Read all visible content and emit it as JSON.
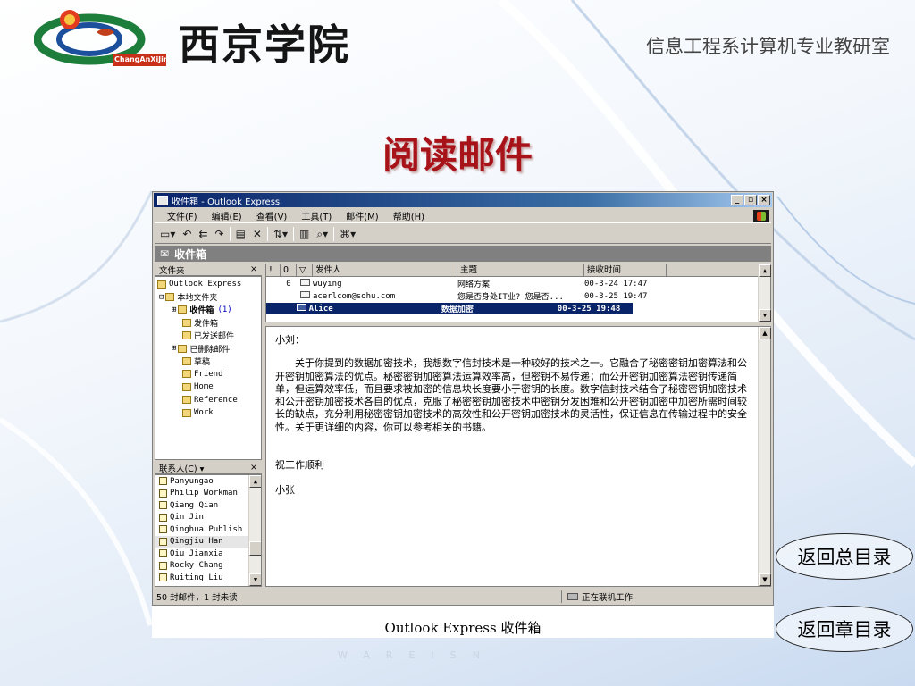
{
  "header": {
    "logo_caption": "ChangAnXiJing",
    "school_name": "西京学院",
    "department": "信息工程系计算机专业教研室"
  },
  "slide_title": "阅读邮件",
  "window": {
    "title": "收件箱 - Outlook Express",
    "menus": [
      "文件(F)",
      "编辑(E)",
      "查看(V)",
      "工具(T)",
      "邮件(M)",
      "帮助(H)"
    ],
    "toolbar_icons": [
      "new-mail-icon",
      "reply-icon",
      "reply-all-icon",
      "forward-icon",
      "print-icon",
      "delete-icon",
      "send-receive-icon",
      "addresses-icon",
      "find-icon",
      "encoding-icon"
    ],
    "folder_bar_title": "收件箱",
    "folders_header": "文件夹",
    "folders": [
      {
        "label": "Outlook Express",
        "level": 0
      },
      {
        "label": "本地文件夹",
        "level": 1
      },
      {
        "label": "收件箱",
        "count": "(1)",
        "level": 2,
        "bold": true
      },
      {
        "label": "发件箱",
        "level": 2
      },
      {
        "label": "已发送邮件",
        "level": 2
      },
      {
        "label": "已删除邮件",
        "level": 2
      },
      {
        "label": "草稿",
        "level": 2
      },
      {
        "label": "Friend",
        "level": 2
      },
      {
        "label": "Home",
        "level": 2
      },
      {
        "label": "Reference",
        "level": 2
      },
      {
        "label": "Work",
        "level": 2
      }
    ],
    "contacts_header": "联系人(C) ▾",
    "contacts": [
      "Panyungao",
      "Philip Workman",
      "Qiang Qian",
      "Qin Jin",
      "Qinghua Publish",
      "Qingjiu Han",
      "Qiu Jianxia",
      "Rocky Chang",
      "Ruiting Liu"
    ],
    "selected_contact": "Qingjiu Han",
    "columns": {
      "flag": "!",
      "attach": "0",
      "watch": "▽",
      "from": "发件人",
      "subject": "主题",
      "date": "接收时间"
    },
    "messages": [
      {
        "attach": "0",
        "from": "wuying",
        "subject": "网络方案",
        "date": "00-3-24 17:47",
        "selected": false
      },
      {
        "attach": "",
        "from": "acerlcom@sohu.com",
        "subject": "您是否身处IT业?  您是否...",
        "date": "00-3-25 19:47",
        "selected": false
      },
      {
        "attach": "",
        "from": "Alice",
        "subject": "数据加密",
        "date": "00-3-25 19:48",
        "selected": true
      }
    ],
    "preview": {
      "greeting": "小刘：",
      "body": "关于你提到的数据加密技术，我想数字信封技术是一种较好的技术之一。它融合了秘密密钥加密算法和公开密钥加密算法的优点。秘密密钥加密算法运算效率高，但密钥不易传递；而公开密钥加密算法密钥传递简单，但运算效率低，而且要求被加密的信息块长度要小于密钥的长度。数字信封技术结合了秘密密钥加密技术和公开密钥加密技术各自的优点，克服了秘密密钥加密技术中密钥分发困难和公开密钥加密中加密所需时间较长的缺点，充分利用秘密密钥加密技术的高效性和公开密钥加密技术的灵活性，保证信息在传输过程中的安全性。关于更详细的内容，你可以参考相关的书籍。",
      "closing": "祝工作顺利",
      "signature": "小张"
    },
    "status_left": "50 封邮件，1 封未读",
    "status_right": "正在联机工作"
  },
  "caption": "Outlook Express 收件箱",
  "nav": {
    "back_to_main": "返回总目录",
    "back_to_chapter": "返回章目录"
  },
  "watermark": "WAREISN"
}
